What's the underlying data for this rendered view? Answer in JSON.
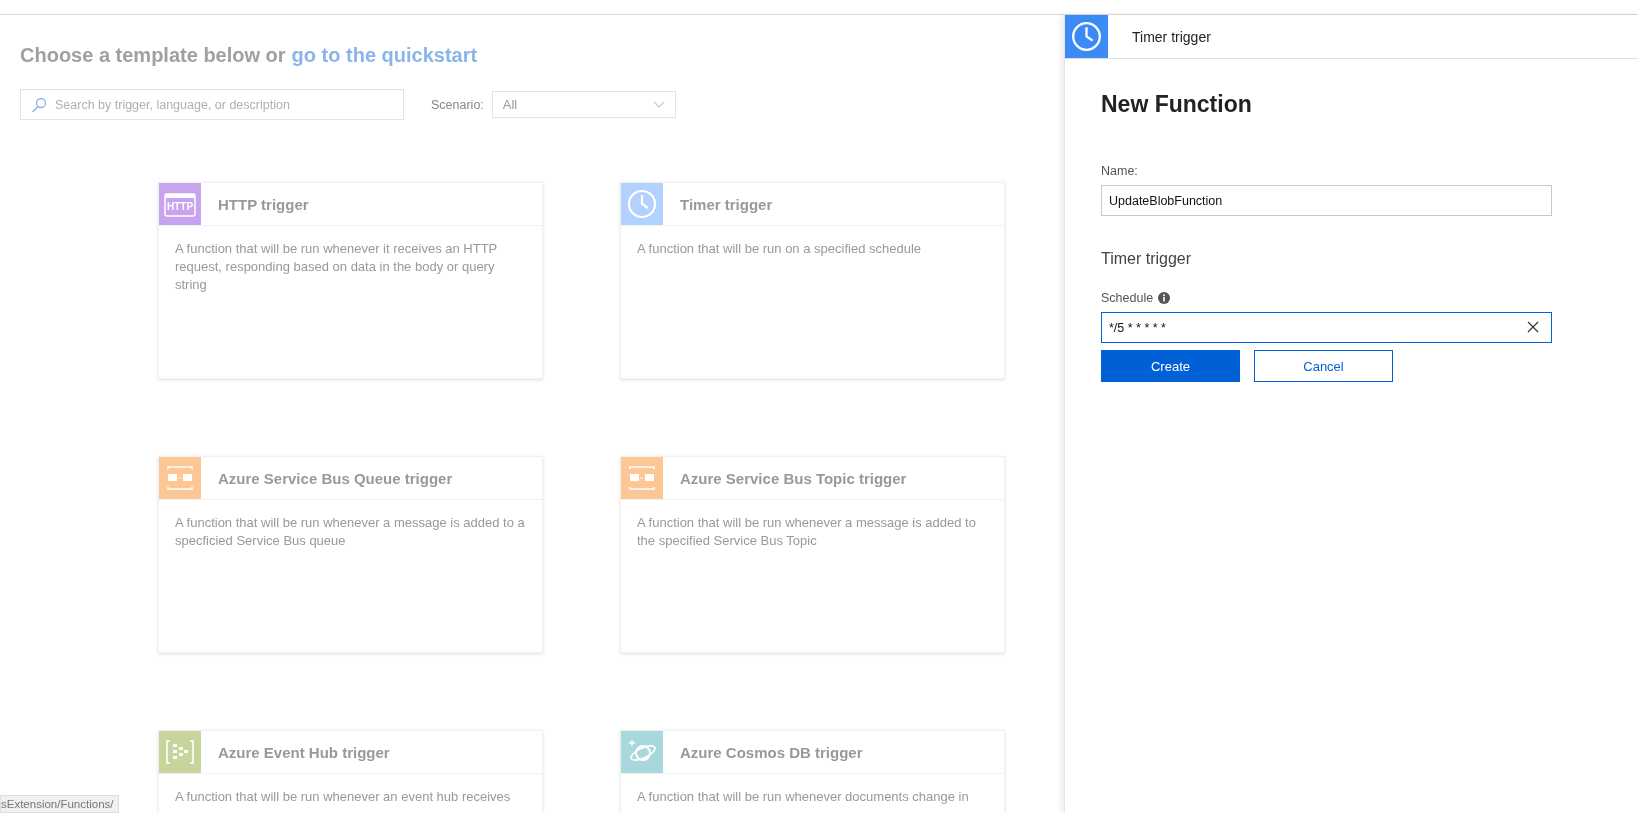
{
  "heading": {
    "text": "Choose a template below or",
    "link": "go to the quickstart"
  },
  "search": {
    "placeholder": "Search by trigger, language, or description"
  },
  "scenario": {
    "label": "Scenario:",
    "value": "All"
  },
  "templates": [
    {
      "title": "HTTP trigger",
      "kind": "http",
      "icon_text": "HTTP",
      "color": "#c8a4f0",
      "description": "A function that will be run whenever it receives an HTTP request, responding based on data in the body or query string"
    },
    {
      "title": "Timer trigger",
      "kind": "clock",
      "color": "#b3d1ff",
      "description": "A function that will be run on a specified schedule"
    },
    {
      "title": "Azure Service Bus Queue trigger",
      "kind": "envelopes",
      "color": "#fcc794",
      "description": "A function that will be run whenever a message is added to a specficied Service Bus queue"
    },
    {
      "title": "Azure Service Bus Topic trigger",
      "kind": "envelopes",
      "color": "#fcc794",
      "description": "A function that will be run whenever a message is added to the specified Service Bus Topic"
    },
    {
      "title": "Azure Event Hub trigger",
      "kind": "hub",
      "color": "#c5d59b",
      "description": "A function that will be run whenever an event hub receives"
    },
    {
      "title": "Azure Cosmos DB trigger",
      "kind": "planet",
      "color": "#a9d8dc",
      "description": "A function that will be run whenever documents change in"
    }
  ],
  "status_bar": {
    "text": "sExtension/Functions/"
  },
  "panel": {
    "title": "Timer trigger",
    "heading": "New Function",
    "name_label": "Name:",
    "name_value": "UpdateBlobFunction",
    "section": "Timer trigger",
    "schedule_label": "Schedule",
    "schedule_value": "*/5 * * * * *",
    "buttons": [
      {
        "label": "Create",
        "kind": "primary"
      },
      {
        "label": "Cancel",
        "kind": "secondary"
      }
    ]
  }
}
